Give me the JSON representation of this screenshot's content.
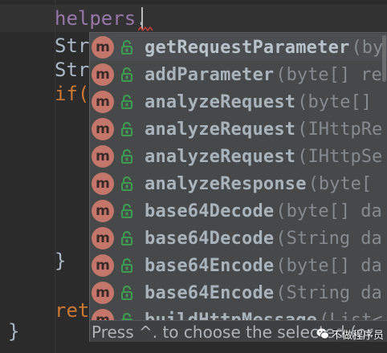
{
  "editor": {
    "lines": [
      {
        "parts": [
          {
            "text": "helpers",
            "style": "purple"
          },
          {
            "text": ".",
            "style": "plain"
          }
        ]
      },
      {
        "parts": [
          {
            "text": "Str",
            "style": "plain"
          }
        ]
      },
      {
        "parts": [
          {
            "text": "Str",
            "style": "plain"
          }
        ]
      },
      {
        "parts": [
          {
            "text": "if(",
            "style": "keyword"
          }
        ]
      },
      {
        "parts": [
          {
            "text": "}",
            "style": "plain"
          }
        ]
      },
      {
        "parts": [
          {
            "text": "ret",
            "style": "keyword"
          }
        ]
      },
      {
        "parts": [
          {
            "text": "}",
            "style": "plain"
          }
        ]
      }
    ]
  },
  "completion": {
    "items": [
      {
        "icon": "method-icon",
        "visibility": "public-lock-icon",
        "name": "getRequestParameter",
        "params": "(by"
      },
      {
        "icon": "method-icon",
        "visibility": "public-lock-icon",
        "name": "addParameter",
        "params": "(byte[] re"
      },
      {
        "icon": "method-icon",
        "visibility": "public-lock-icon",
        "name": "analyzeRequest",
        "params": "(byte[]"
      },
      {
        "icon": "method-icon",
        "visibility": "public-lock-icon",
        "name": "analyzeRequest",
        "params": "(IHttpRe"
      },
      {
        "icon": "method-icon",
        "visibility": "public-lock-icon",
        "name": "analyzeRequest",
        "params": "(IHttpSe"
      },
      {
        "icon": "method-icon",
        "visibility": "public-lock-icon",
        "name": "analyzeResponse",
        "params": "(byte["
      },
      {
        "icon": "method-icon",
        "visibility": "public-lock-icon",
        "name": "base64Decode",
        "params": "(byte[] da"
      },
      {
        "icon": "method-icon",
        "visibility": "public-lock-icon",
        "name": "base64Decode",
        "params": "(String da"
      },
      {
        "icon": "method-icon",
        "visibility": "public-lock-icon",
        "name": "base64Encode",
        "params": "(byte[] da"
      },
      {
        "icon": "method-icon",
        "visibility": "public-lock-icon",
        "name": "base64Encode",
        "params": "(String da"
      },
      {
        "icon": "method-icon",
        "visibility": "public-lock-icon",
        "name": "buildHttpMessage",
        "params": "(List<"
      }
    ],
    "selected_index": 0,
    "method_badge_letter": "m",
    "footer": "Press ^. to choose the selected (or"
  },
  "watermark": {
    "text": "不做程序员"
  },
  "colors": {
    "background": "#2b2b2b",
    "popup": "#46484a",
    "method_badge": "#c4766a",
    "lock": "#3d9a50",
    "keyword": "#cc7832",
    "identifier": "#9876aa"
  }
}
